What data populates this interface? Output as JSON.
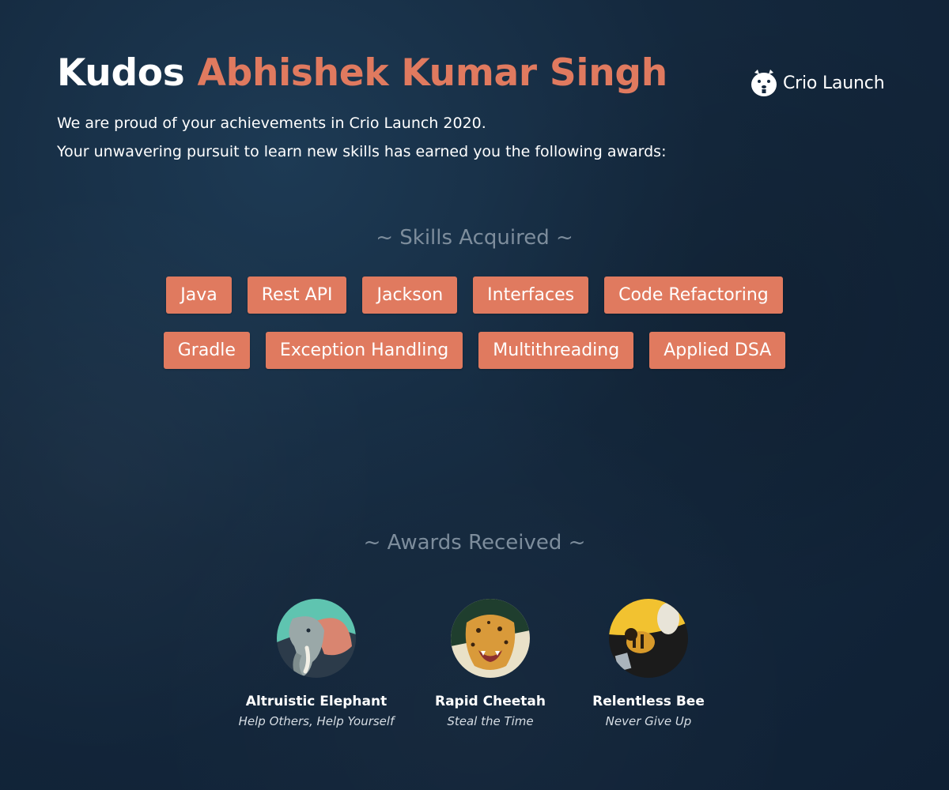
{
  "header": {
    "kudos": "Kudos",
    "name": "Abhishek Kumar Singh",
    "line1": "We are proud of your achievements in Crio Launch 2020.",
    "line2": "Your unwavering pursuit to learn new skills has earned you the following awards:"
  },
  "logo": {
    "text": "Crio Launch",
    "icon": "crio-beaver-icon"
  },
  "skills": {
    "title": "~ Skills Acquired ~",
    "row1": [
      "Java",
      "Rest API",
      "Jackson",
      "Interfaces",
      "Code Refactoring"
    ],
    "row2": [
      "Gradle",
      "Exception Handling",
      "Multithreading",
      "Applied DSA"
    ]
  },
  "awards": {
    "title": "~ Awards Received ~",
    "items": [
      {
        "name": "Altruistic Elephant",
        "motto": "Help Others, Help Yourself",
        "icon": "elephant-icon"
      },
      {
        "name": "Rapid Cheetah",
        "motto": "Steal the Time",
        "icon": "cheetah-icon"
      },
      {
        "name": "Relentless Bee",
        "motto": "Never Give Up",
        "icon": "bee-icon"
      }
    ]
  },
  "colors": {
    "accent": "#e07a5f",
    "background": "#14283d",
    "muted": "#7d8d9c"
  }
}
